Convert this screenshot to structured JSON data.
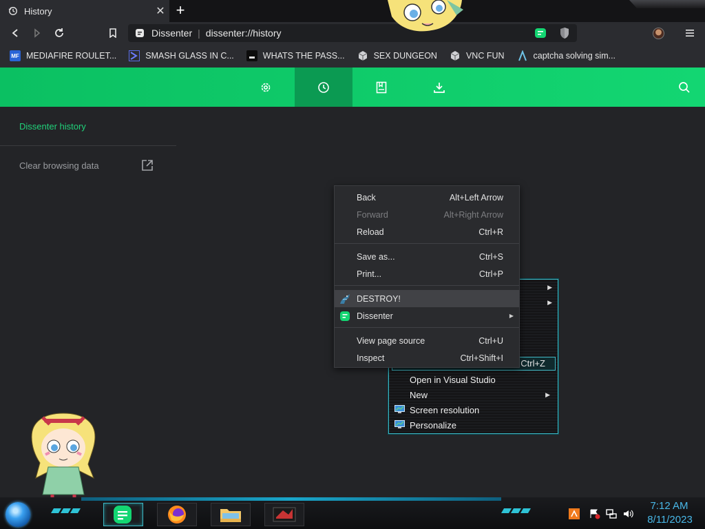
{
  "tab": {
    "title": "History",
    "close": "✕",
    "new_tab": "+"
  },
  "omnibox": {
    "site_name": "Dissenter",
    "url": "dissenter://history"
  },
  "bookmarks": [
    {
      "label": "MEDIAFIRE ROULET...",
      "icon": "mediafire-icon",
      "badge": "MF"
    },
    {
      "label": "SMASH GLASS IN C...",
      "icon": "chevron-logo-icon"
    },
    {
      "label": "WHATS THE PASS...",
      "icon": "dark-square-icon"
    },
    {
      "label": "SEX DUNGEON",
      "icon": "cube-icon"
    },
    {
      "label": "VNC FUN",
      "icon": "cube-icon"
    },
    {
      "label": "captcha solving sim...",
      "icon": "lambda-icon"
    }
  ],
  "header": {
    "nav": [
      "settings",
      "history",
      "bookmarks",
      "downloads"
    ],
    "active": "history",
    "accent": "#13d672"
  },
  "sidebar": {
    "title": "Dissenter history",
    "clear": "Clear browsing data"
  },
  "context_menu": {
    "items": [
      {
        "label": "Back",
        "shortcut": "Alt+Left Arrow",
        "disabled": false
      },
      {
        "label": "Forward",
        "shortcut": "Alt+Right Arrow",
        "disabled": true
      },
      {
        "label": "Reload",
        "shortcut": "Ctrl+R",
        "disabled": false
      },
      {
        "label": "Save as...",
        "shortcut": "Ctrl+S",
        "disabled": false
      },
      {
        "label": "Print...",
        "shortcut": "Ctrl+P",
        "disabled": false
      },
      {
        "label": "DESTROY!",
        "shortcut": "",
        "disabled": false,
        "icon": "dragon-icon"
      },
      {
        "label": "Dissenter",
        "shortcut": "",
        "disabled": false,
        "icon": "dissenter-icon",
        "submenu": true
      },
      {
        "label": "View page source",
        "shortcut": "Ctrl+U",
        "disabled": false
      },
      {
        "label": "Inspect",
        "shortcut": "Ctrl+Shift+I",
        "disabled": false
      }
    ]
  },
  "desktop_menu": {
    "highlight_shortcut": "Ctrl+Z",
    "items": [
      {
        "label": "Open in Visual Studio"
      },
      {
        "label": "New",
        "submenu": true
      },
      {
        "label": "Screen resolution",
        "icon": "monitor-icon"
      },
      {
        "label": "Personalize",
        "icon": "monitor-icon"
      }
    ],
    "accent": "#3fb6c2"
  },
  "taskbar": {
    "time": "7:12 AM",
    "date": "8/11/2023",
    "accent": "#2ec3d6"
  }
}
